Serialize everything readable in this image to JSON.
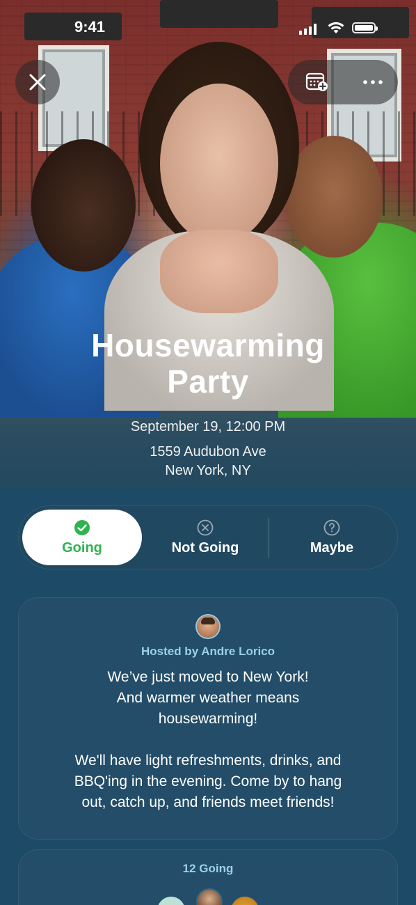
{
  "status_bar": {
    "time": "9:41"
  },
  "top_controls": {
    "close_icon": "close-icon",
    "calendar_icon": "calendar-add-icon",
    "more_icon": "more-icon"
  },
  "event": {
    "title_line1": "Housewarming",
    "title_line2": "Party",
    "date": "September 19, 12:00 PM",
    "address_line1": "1559 Audubon Ave",
    "address_line2": "New York, NY"
  },
  "rsvp": {
    "options": [
      {
        "label": "Going",
        "icon": "check-circle-icon",
        "selected": true
      },
      {
        "label": "Not Going",
        "icon": "x-circle-icon",
        "selected": false
      },
      {
        "label": "Maybe",
        "icon": "question-circle-icon",
        "selected": false
      }
    ],
    "accent_color": "#2fb350"
  },
  "host_card": {
    "hosted_by": "Hosted by Andre Lorico",
    "message_lines": [
      "We’ve just moved to New York!",
      "And warmer weather means",
      "housewarming!",
      "",
      "We'll have light refreshments, drinks, and",
      "BBQ'ing in the evening. Come by to hang",
      "out, catch up, and friends meet friends!"
    ]
  },
  "going_card": {
    "count_label": "12 Going"
  }
}
